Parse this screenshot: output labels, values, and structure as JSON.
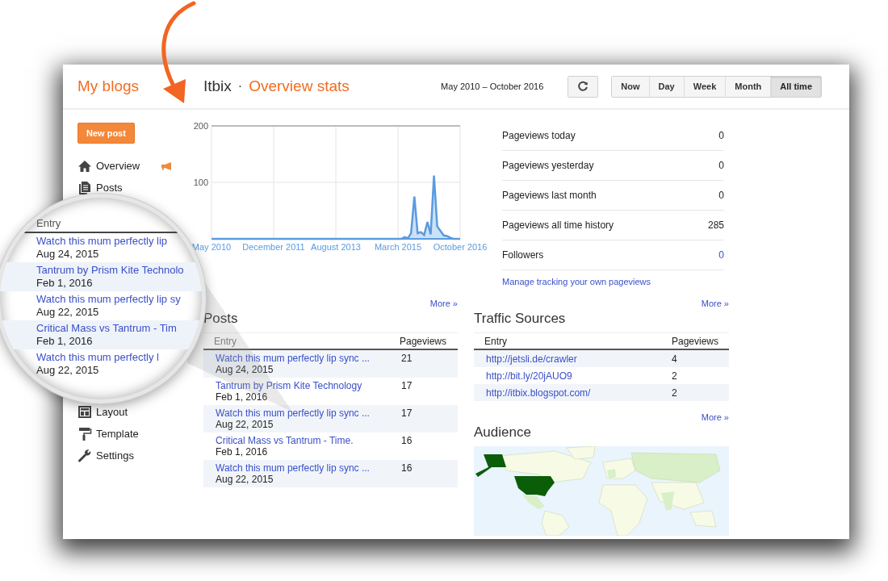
{
  "header": {
    "my_blogs": "My blogs",
    "blog_name": "Itbix",
    "separator": "·",
    "page_title": "Overview stats",
    "date_range": "May 2010 – October 2016",
    "ranges": [
      {
        "label": "Now",
        "selected": false
      },
      {
        "label": "Day",
        "selected": false
      },
      {
        "label": "Week",
        "selected": false
      },
      {
        "label": "Month",
        "selected": false
      },
      {
        "label": "All time",
        "selected": true
      }
    ]
  },
  "sidebar": {
    "new_post": "New post",
    "items": [
      {
        "label": "Overview"
      },
      {
        "label": "Posts"
      },
      {
        "label": "Layout"
      },
      {
        "label": "Template"
      },
      {
        "label": "Settings"
      }
    ]
  },
  "chart": {
    "chart_data": {
      "type": "area",
      "grid": true,
      "ylim": [
        0,
        200
      ],
      "yticks": [
        100,
        200
      ],
      "categories": [
        "May 2010",
        null,
        null,
        null,
        null,
        null,
        null,
        null,
        null,
        null,
        null,
        null,
        null,
        null,
        null,
        null,
        null,
        null,
        null,
        "December 2011",
        null,
        null,
        null,
        null,
        null,
        null,
        null,
        null,
        null,
        null,
        null,
        null,
        null,
        null,
        null,
        null,
        null,
        null,
        "August 2013",
        null,
        null,
        null,
        null,
        null,
        null,
        null,
        null,
        null,
        null,
        null,
        null,
        null,
        null,
        null,
        null,
        null,
        null,
        "March 2015",
        null,
        null,
        null,
        null,
        null,
        null,
        null,
        null,
        null,
        null,
        null,
        null,
        null,
        null,
        null,
        null,
        null,
        null,
        "October 2016"
      ],
      "series": [
        {
          "color": "#5a9be0",
          "values": [
            0,
            0,
            0,
            0,
            0,
            0,
            0,
            0,
            0,
            0,
            0,
            0,
            0,
            0,
            0,
            0,
            0,
            0,
            0,
            0,
            0,
            0,
            0,
            0,
            0,
            0,
            0,
            0,
            0,
            0,
            0,
            0,
            0,
            0,
            0,
            0,
            0,
            0,
            0,
            0,
            0,
            0,
            0,
            0,
            0,
            0,
            0,
            0,
            0,
            0,
            0,
            0,
            0,
            0,
            0,
            0,
            0,
            0,
            0,
            3,
            1,
            10,
            75,
            10,
            12,
            7,
            30,
            8,
            112,
            22,
            14,
            6,
            5,
            2,
            0,
            0,
            0
          ]
        }
      ]
    }
  },
  "stats": {
    "rows": [
      {
        "label": "Pageviews today",
        "value": "0",
        "kind": "plain"
      },
      {
        "label": "Pageviews yesterday",
        "value": "0",
        "kind": "plain"
      },
      {
        "label": "Pageviews last month",
        "value": "0",
        "kind": "plain"
      },
      {
        "label": "Pageviews all time history",
        "value": "285",
        "kind": "plain"
      },
      {
        "label": "Followers",
        "value": "0",
        "kind": "link"
      }
    ],
    "manage_link": "Manage tracking your own pageviews"
  },
  "posts": {
    "more": "More »",
    "title": "Posts",
    "columns": [
      "Entry",
      "Pageviews"
    ],
    "rows": [
      {
        "title": "Watch this mum perfectly lip sync ...",
        "date": "Aug 24, 2015",
        "pageviews": "21"
      },
      {
        "title": "Tantrum by Prism Kite Technology",
        "date": "Feb 1, 2016",
        "pageviews": "17"
      },
      {
        "title": "Watch this mum perfectly lip sync ...",
        "date": "Aug 22, 2015",
        "pageviews": "17"
      },
      {
        "title": "Critical Mass vs Tantrum - Time.",
        "date": "Feb 1, 2016",
        "pageviews": "16"
      },
      {
        "title": "Watch this mum perfectly lip sync ...",
        "date": "Aug 22, 2015",
        "pageviews": "16"
      }
    ]
  },
  "traffic_sources": {
    "more": "More »",
    "title": "Traffic Sources",
    "columns": [
      "Entry",
      "Pageviews"
    ],
    "rows": [
      {
        "entry": "http://jetsli.de/crawler",
        "pageviews": "4"
      },
      {
        "entry": "http://bit.ly/20jAUO9",
        "pageviews": "2"
      },
      {
        "entry": "http://itbix.blogspot.com/",
        "pageviews": "2"
      }
    ]
  },
  "audience": {
    "more": "More »",
    "title": "Audience"
  },
  "magnifier": {
    "header": "Entry",
    "rows": [
      {
        "title": "Watch this mum perfectly lip",
        "date": "Aug 24, 2015"
      },
      {
        "title": "Tantrum by Prism Kite Technolo",
        "date": "Feb 1, 2016"
      },
      {
        "title": "Watch this mum perfectly lip sy",
        "date": "Aug 22, 2015"
      },
      {
        "title": "Critical Mass vs Tantrum - Tim",
        "date": "Feb 1, 2016"
      },
      {
        "title": "Watch this mum perfectly l",
        "date": "Aug 22, 2015"
      }
    ]
  }
}
